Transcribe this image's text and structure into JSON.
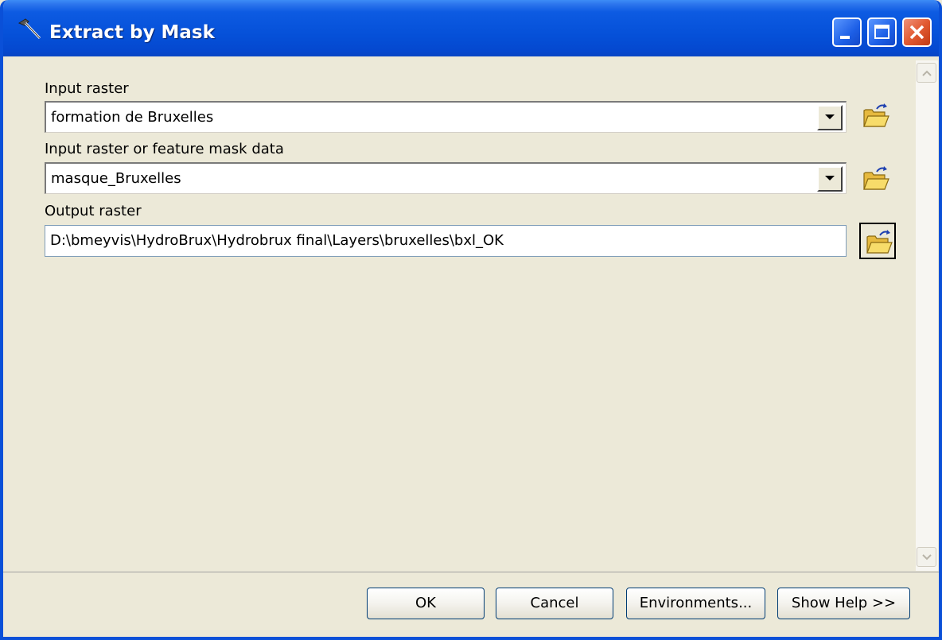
{
  "window": {
    "title": "Extract by Mask",
    "icon": "hammer-icon"
  },
  "fields": {
    "input_raster": {
      "label": "Input raster",
      "value": "formation de Bruxelles"
    },
    "mask": {
      "label": "Input raster or feature mask data",
      "value": "masque_Bruxelles"
    },
    "output_raster": {
      "label": "Output raster",
      "value": "D:\\bmeyvis\\HydroBrux\\Hydrobrux final\\Layers\\bruxelles\\bxl_OK"
    }
  },
  "buttons": {
    "ok": "OK",
    "cancel": "Cancel",
    "environments": "Environments...",
    "help": "Show Help >>"
  },
  "colors": {
    "titlebar": "#0550d8",
    "dialog_bg": "#ece9d8",
    "close_button": "#e25a32",
    "folder_icon": "#f2d052"
  }
}
